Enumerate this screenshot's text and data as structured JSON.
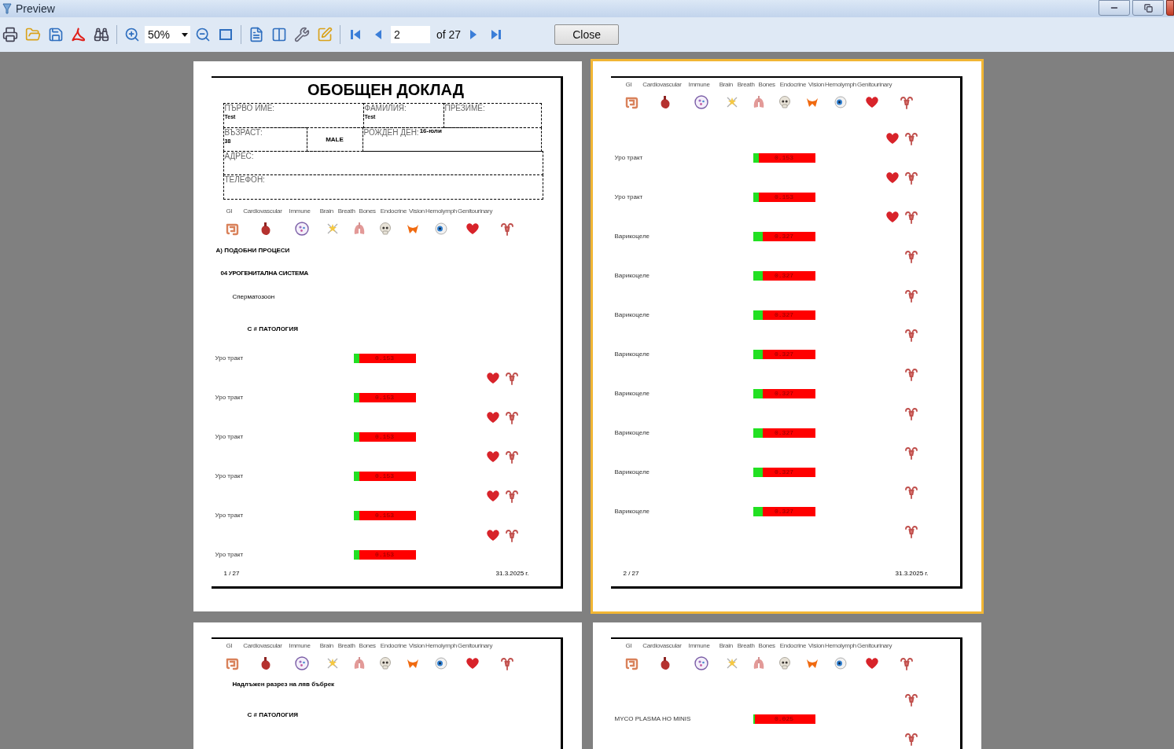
{
  "window": {
    "title": "Preview"
  },
  "toolbar": {
    "zoom": "50%",
    "page": "2",
    "page_count": "of 27",
    "close": "Close"
  },
  "pages": [
    {
      "selected": false,
      "title": "ОБОБЩЕН ДОКЛАД",
      "form": [
        {
          "cells": [
            {
              "label": "ПЪРВО ИМЕ:",
              "value": "Test"
            },
            {
              "label": "ФАМИЛИЯ:",
              "value": "Test"
            },
            {
              "label": "ПРЕЗИМЕ:"
            }
          ]
        },
        {
          "cells": [
            {
              "label": "ВЪЗРАСТ:",
              "value": "38"
            },
            {
              "value": "MALE"
            },
            {
              "label": "РОЖДЕН ДЕН:",
              "note": "16-юли"
            }
          ]
        },
        {
          "cells": [
            {
              "label": "АДРЕС:"
            }
          ]
        },
        {
          "cells": [
            {
              "label": "ТЕЛЕФОН:"
            }
          ]
        }
      ],
      "organs": [
        {
          "label": "GI",
          "kind": "intestine"
        },
        {
          "label": "Cardiovascular",
          "kind": "anatomical-heart"
        },
        {
          "label": "Immune",
          "kind": "cell"
        },
        {
          "label": "Brain",
          "kind": "nerve"
        },
        {
          "label": "Breath",
          "kind": "lungs"
        },
        {
          "label": "Bones",
          "kind": "skull"
        },
        {
          "label": "Endocrine",
          "kind": "thyroid"
        },
        {
          "label": "Vision",
          "kind": "eye"
        },
        {
          "label": "Hemolymph",
          "kind": "heart"
        },
        {
          "label": "Genitourinary",
          "kind": "uterus"
        }
      ],
      "blocks": [
        {
          "kind": "heading",
          "text": "А) ПОДОБНИ ПРОЦЕСИ"
        },
        {
          "kind": "section",
          "text": "04 УРОГЕНИТАЛНА СИСТЕМА"
        },
        {
          "kind": "subsection",
          "text": "Сперматозоон"
        },
        {
          "kind": "pathology",
          "text": "С # ПАТОЛОГИЯ"
        },
        {
          "kind": "result",
          "label": "Уро тракт",
          "value": "0.153",
          "level": 0.09
        },
        {
          "kind": "icons",
          "icons": [
            {
              "kind": "heart"
            },
            {
              "kind": "uterus"
            }
          ]
        },
        {
          "kind": "result",
          "label": "Уро тракт",
          "value": "0.153",
          "level": 0.09
        },
        {
          "kind": "icons",
          "icons": [
            {
              "kind": "heart"
            },
            {
              "kind": "uterus"
            }
          ]
        },
        {
          "kind": "result",
          "label": "Уро тракт",
          "value": "0.153",
          "level": 0.09
        },
        {
          "kind": "icons",
          "icons": [
            {
              "kind": "heart"
            },
            {
              "kind": "uterus"
            }
          ]
        },
        {
          "kind": "result",
          "label": "Уро тракт",
          "value": "0.153",
          "level": 0.09
        },
        {
          "kind": "icons",
          "icons": [
            {
              "kind": "heart"
            },
            {
              "kind": "uterus"
            }
          ]
        },
        {
          "kind": "result",
          "label": "Уро тракт",
          "value": "0.153",
          "level": 0.09
        },
        {
          "kind": "icons",
          "icons": [
            {
              "kind": "heart"
            },
            {
              "kind": "uterus"
            }
          ]
        },
        {
          "kind": "result",
          "label": "Уро тракт",
          "value": "0.153",
          "level": 0.09
        }
      ],
      "footer": {
        "page": "1 / 27",
        "date": "31.3.2025 г."
      }
    },
    {
      "selected": true,
      "organs": [
        {
          "label": "GI",
          "kind": "intestine"
        },
        {
          "label": "Cardiovascular",
          "kind": "anatomical-heart"
        },
        {
          "label": "Immune",
          "kind": "cell"
        },
        {
          "label": "Brain",
          "kind": "nerve"
        },
        {
          "label": "Breath",
          "kind": "lungs"
        },
        {
          "label": "Bones",
          "kind": "skull"
        },
        {
          "label": "Endocrine",
          "kind": "thyroid"
        },
        {
          "label": "Vision",
          "kind": "eye"
        },
        {
          "label": "Hemolymph",
          "kind": "heart"
        },
        {
          "label": "Genitourinary",
          "kind": "uterus"
        }
      ],
      "blocks": [
        {
          "kind": "icons",
          "icons": [
            {
              "kind": "heart"
            },
            {
              "kind": "uterus"
            }
          ]
        },
        {
          "kind": "result",
          "label": "Уро тракт",
          "value": "0.153",
          "level": 0.09
        },
        {
          "kind": "icons",
          "icons": [
            {
              "kind": "heart"
            },
            {
              "kind": "uterus"
            }
          ]
        },
        {
          "kind": "result",
          "label": "Уро тракт",
          "value": "0.153",
          "level": 0.09
        },
        {
          "kind": "icons",
          "icons": [
            {
              "kind": "heart"
            },
            {
              "kind": "uterus"
            }
          ]
        },
        {
          "kind": "result",
          "label": "Варикоцеле",
          "value": "0.327",
          "level": 0.16
        },
        {
          "kind": "icons",
          "icons": [
            {
              "kind": "uterus"
            }
          ]
        },
        {
          "kind": "result",
          "label": "Варикоцеле",
          "value": "0.327",
          "level": 0.16
        },
        {
          "kind": "icons",
          "icons": [
            {
              "kind": "uterus"
            }
          ]
        },
        {
          "kind": "result",
          "label": "Варикоцеле",
          "value": "0.327",
          "level": 0.16
        },
        {
          "kind": "icons",
          "icons": [
            {
              "kind": "uterus"
            }
          ]
        },
        {
          "kind": "result",
          "label": "Варикоцеле",
          "value": "0.327",
          "level": 0.16
        },
        {
          "kind": "icons",
          "icons": [
            {
              "kind": "uterus"
            }
          ]
        },
        {
          "kind": "result",
          "label": "Варикоцеле",
          "value": "0.327",
          "level": 0.16
        },
        {
          "kind": "icons",
          "icons": [
            {
              "kind": "uterus"
            }
          ]
        },
        {
          "kind": "result",
          "label": "Варикоцеле",
          "value": "0.327",
          "level": 0.16
        },
        {
          "kind": "icons",
          "icons": [
            {
              "kind": "uterus"
            }
          ]
        },
        {
          "kind": "result",
          "label": "Варикоцеле",
          "value": "0.327",
          "level": 0.16
        },
        {
          "kind": "icons",
          "icons": [
            {
              "kind": "uterus"
            }
          ]
        },
        {
          "kind": "result",
          "label": "Варикоцеле",
          "value": "0.327",
          "level": 0.16
        },
        {
          "kind": "icons",
          "icons": [
            {
              "kind": "uterus"
            }
          ]
        }
      ],
      "footer": {
        "page": "2 / 27",
        "date": "31.3.2025 г."
      }
    },
    {
      "selected": false,
      "organs": [
        {
          "label": "GI",
          "kind": "intestine"
        },
        {
          "label": "Cardiovascular",
          "kind": "anatomical-heart"
        },
        {
          "label": "Immune",
          "kind": "cell"
        },
        {
          "label": "Brain",
          "kind": "nerve"
        },
        {
          "label": "Breath",
          "kind": "lungs"
        },
        {
          "label": "Bones",
          "kind": "skull"
        },
        {
          "label": "Endocrine",
          "kind": "thyroid"
        },
        {
          "label": "Vision",
          "kind": "eye"
        },
        {
          "label": "Hemolymph",
          "kind": "heart"
        },
        {
          "label": "Genitourinary",
          "kind": "uterus"
        }
      ],
      "blocks": [
        {
          "kind": "note",
          "text": "Надлъжен разрез на ляв бъбрек"
        },
        {
          "kind": "pathology",
          "text": "С # ПАТОЛОГИЯ"
        }
      ]
    },
    {
      "selected": false,
      "organs": [
        {
          "label": "GI",
          "kind": "intestine"
        },
        {
          "label": "Cardiovascular",
          "kind": "anatomical-heart"
        },
        {
          "label": "Immune",
          "kind": "cell"
        },
        {
          "label": "Brain",
          "kind": "nerve"
        },
        {
          "label": "Breath",
          "kind": "lungs"
        },
        {
          "label": "Bones",
          "kind": "skull"
        },
        {
          "label": "Endocrine",
          "kind": "thyroid"
        },
        {
          "label": "Vision",
          "kind": "eye"
        },
        {
          "label": "Hemolymph",
          "kind": "heart"
        },
        {
          "label": "Genitourinary",
          "kind": "uterus"
        }
      ],
      "blocks": [
        {
          "kind": "icons",
          "icons": [
            {
              "kind": "uterus"
            }
          ]
        },
        {
          "kind": "result",
          "label": "MYCO PLASMA HO MINIS",
          "value": "0.025",
          "level": 0.03
        },
        {
          "kind": "icons",
          "icons": [
            {
              "kind": "uterus"
            }
          ]
        }
      ]
    }
  ]
}
